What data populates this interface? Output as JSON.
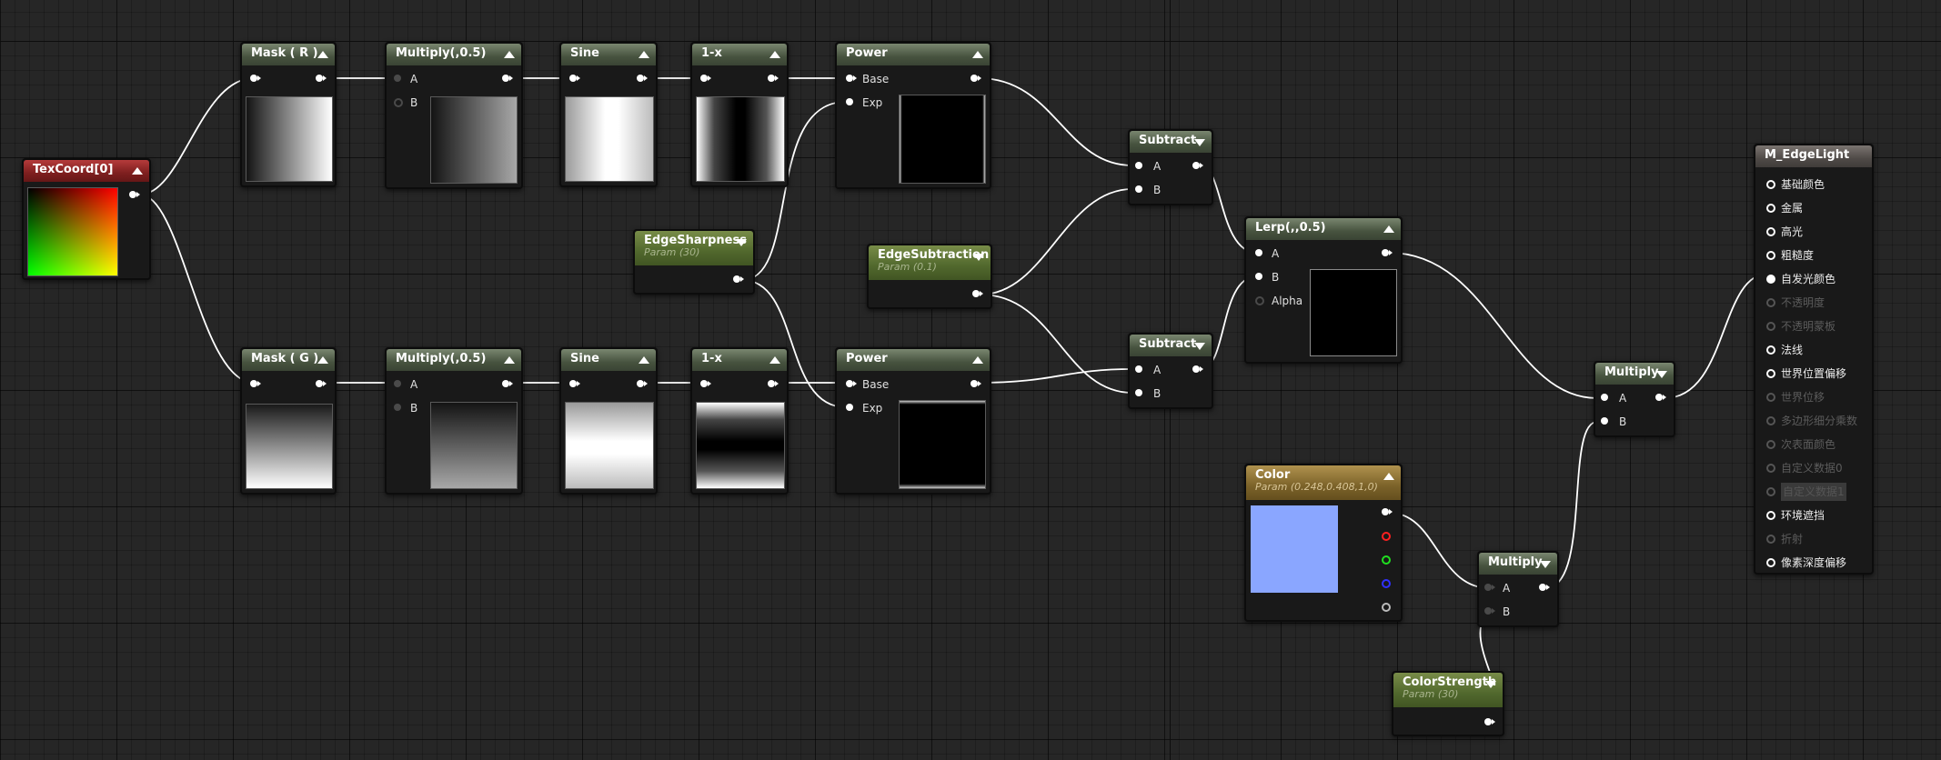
{
  "graph": {
    "texcoord": {
      "title": "TexCoord[0]"
    },
    "mask_r": {
      "title": "Mask ( R )"
    },
    "multiply_r": {
      "title": "Multiply(,0.5)",
      "pin_a": "A",
      "pin_b": "B"
    },
    "sine_r": {
      "title": "Sine"
    },
    "oneminus_r": {
      "title": "1-x"
    },
    "power_r": {
      "title": "Power",
      "pin_base": "Base",
      "pin_exp": "Exp"
    },
    "edge_sharpness": {
      "title": "EdgeSharpness",
      "subtitle": "Param (30)"
    },
    "edge_subtraction": {
      "title": "EdgeSubtraction",
      "subtitle": "Param (0.1)"
    },
    "subtract_top": {
      "title": "Subtract",
      "pin_a": "A",
      "pin_b": "B"
    },
    "lerp": {
      "title": "Lerp(,,0.5)",
      "pin_a": "A",
      "pin_b": "B",
      "pin_alpha": "Alpha"
    },
    "mask_g": {
      "title": "Mask ( G )"
    },
    "multiply_g": {
      "title": "Multiply(,0.5)",
      "pin_a": "A",
      "pin_b": "B"
    },
    "sine_g": {
      "title": "Sine"
    },
    "oneminus_g": {
      "title": "1-x"
    },
    "power_g": {
      "title": "Power",
      "pin_base": "Base",
      "pin_exp": "Exp"
    },
    "subtract_bottom": {
      "title": "Subtract",
      "pin_a": "A",
      "pin_b": "B"
    },
    "color_param": {
      "title": "Color",
      "subtitle": "Param (0.248,0.408,1,0)",
      "swatch": "#8aa6ff"
    },
    "multiply_color": {
      "title": "Multiply",
      "pin_a": "A",
      "pin_b": "B"
    },
    "color_strength": {
      "title": "ColorStrength",
      "subtitle": "Param (30)"
    },
    "multiply_final": {
      "title": "Multiply",
      "pin_a": "A",
      "pin_b": "B"
    },
    "material": {
      "title": "M_EdgeLight",
      "inputs": [
        {
          "label": "基础颜色",
          "state": "enabled"
        },
        {
          "label": "金属",
          "state": "enabled"
        },
        {
          "label": "高光",
          "state": "enabled"
        },
        {
          "label": "粗糙度",
          "state": "enabled"
        },
        {
          "label": "自发光颜色",
          "state": "connected"
        },
        {
          "label": "不透明度",
          "state": "disabled"
        },
        {
          "label": "不透明蒙板",
          "state": "disabled"
        },
        {
          "label": "法线",
          "state": "enabled"
        },
        {
          "label": "世界位置偏移",
          "state": "enabled"
        },
        {
          "label": "世界位移",
          "state": "disabled"
        },
        {
          "label": "多边形细分乘数",
          "state": "disabled"
        },
        {
          "label": "次表面颜色",
          "state": "disabled"
        },
        {
          "label": "自定义数据0",
          "state": "disabled"
        },
        {
          "label": "自定义数据1",
          "state": "highlight"
        },
        {
          "label": "环境遮挡",
          "state": "enabled"
        },
        {
          "label": "折射",
          "state": "disabled"
        },
        {
          "label": "像素深度偏移",
          "state": "enabled"
        }
      ]
    }
  },
  "colors": {
    "wire": "#ffffff",
    "node_header_green": "#51682d",
    "node_header_red": "#7e1f1f",
    "node_header_gold": "#7b6229",
    "swatch_blue": "#8aa6ff",
    "pin_red": "#ff2020",
    "pin_green": "#20e020",
    "pin_blue": "#2020ff"
  }
}
